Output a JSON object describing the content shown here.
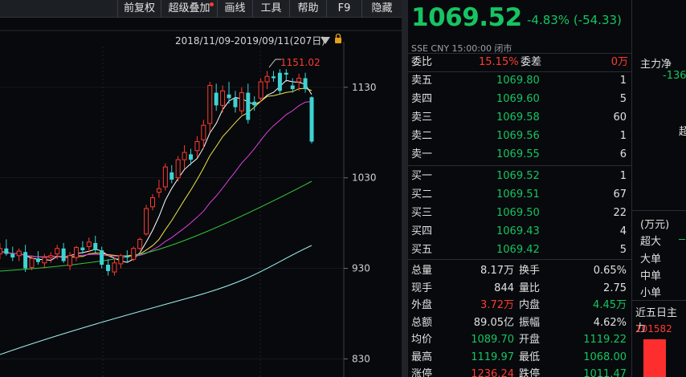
{
  "toolbar": {
    "items": [
      "前复权",
      "超级叠加",
      "画线",
      "工具",
      "帮助",
      "F9",
      "隐藏"
    ]
  },
  "chart": {
    "range_label": "2018/11/09-2019/09/11(207日)",
    "max_label": "1151.02",
    "y_ticks": [
      "1130",
      "1030",
      "930",
      "830"
    ],
    "ylim": [
      810,
      1175
    ]
  },
  "chart_data": {
    "type": "candlestick",
    "y_ticks": [
      1130,
      1030,
      930,
      830
    ],
    "max_price": 1151.02,
    "candles": [
      [
        940,
        950,
        932,
        945
      ],
      [
        946,
        958,
        940,
        952
      ],
      [
        952,
        962,
        944,
        946
      ],
      [
        946,
        954,
        938,
        942
      ],
      [
        944,
        952,
        938,
        949
      ],
      [
        948,
        956,
        926,
        930
      ],
      [
        931,
        944,
        928,
        941
      ],
      [
        941,
        949,
        934,
        937
      ],
      [
        936,
        946,
        930,
        942
      ],
      [
        942,
        948,
        936,
        944
      ],
      [
        946,
        956,
        940,
        952
      ],
      [
        952,
        958,
        936,
        938
      ],
      [
        933,
        948,
        928,
        944
      ],
      [
        942,
        955,
        938,
        953
      ],
      [
        953,
        960,
        946,
        950
      ],
      [
        954,
        964,
        948,
        959
      ],
      [
        958,
        966,
        947,
        950
      ],
      [
        950,
        954,
        930,
        934
      ],
      [
        934,
        940,
        922,
        927
      ],
      [
        926,
        942,
        922,
        936
      ],
      [
        935,
        946,
        930,
        944
      ],
      [
        944,
        950,
        936,
        942
      ],
      [
        940,
        954,
        938,
        952
      ],
      [
        952,
        964,
        950,
        962
      ],
      [
        968,
        1000,
        966,
        996
      ],
      [
        998,
        1012,
        994,
        1008
      ],
      [
        1014,
        1028,
        1008,
        1018
      ],
      [
        1020,
        1046,
        1016,
        1042
      ],
      [
        1036,
        1044,
        1024,
        1028
      ],
      [
        1030,
        1054,
        1026,
        1050
      ],
      [
        1050,
        1066,
        1040,
        1058
      ],
      [
        1056,
        1062,
        1044,
        1050
      ],
      [
        1060,
        1076,
        1052,
        1070
      ],
      [
        1072,
        1094,
        1062,
        1088
      ],
      [
        1090,
        1136,
        1080,
        1132
      ],
      [
        1124,
        1134,
        1104,
        1110
      ],
      [
        1110,
        1132,
        1102,
        1126
      ],
      [
        1122,
        1136,
        1112,
        1118
      ],
      [
        1118,
        1126,
        1102,
        1108
      ],
      [
        1104,
        1130,
        1100,
        1124
      ],
      [
        1124,
        1134,
        1090,
        1094
      ],
      [
        1114,
        1120,
        1104,
        1110
      ],
      [
        1118,
        1140,
        1114,
        1136
      ],
      [
        1136,
        1148,
        1128,
        1142
      ],
      [
        1142,
        1148,
        1136,
        1140
      ],
      [
        1146,
        1150,
        1122,
        1126
      ],
      [
        1146,
        1150,
        1136,
        1144
      ],
      [
        1132,
        1140,
        1124,
        1128
      ],
      [
        1136,
        1145,
        1126,
        1140
      ],
      [
        1140,
        1146,
        1124,
        1128
      ],
      [
        1119,
        1120,
        1068,
        1070
      ]
    ]
  },
  "quote": {
    "price": "1069.52",
    "change": "-4.83%  (-54.33)",
    "meta": "SSE  CNY  15:00:00  闭市",
    "weibi_label": "委比",
    "weibi_value": "15.15%",
    "weicha_label": "委差",
    "weicha_value": "0万"
  },
  "asks": [
    {
      "label": "卖五",
      "price": "1069.80",
      "vol": "1"
    },
    {
      "label": "卖四",
      "price": "1069.60",
      "vol": "5"
    },
    {
      "label": "卖三",
      "price": "1069.58",
      "vol": "60"
    },
    {
      "label": "卖二",
      "price": "1069.56",
      "vol": "1"
    },
    {
      "label": "卖一",
      "price": "1069.55",
      "vol": "6"
    }
  ],
  "bids": [
    {
      "label": "买一",
      "price": "1069.52",
      "vol": "1"
    },
    {
      "label": "买二",
      "price": "1069.51",
      "vol": "67"
    },
    {
      "label": "买三",
      "price": "1069.50",
      "vol": "22"
    },
    {
      "label": "买四",
      "price": "1069.43",
      "vol": "4"
    },
    {
      "label": "买五",
      "price": "1069.42",
      "vol": "5"
    }
  ],
  "stats": [
    {
      "l1": "总量",
      "v1": "8.17万",
      "c1": "#e0e0e0",
      "l2": "换手",
      "v2": "0.65%",
      "c2": "#e0e0e0"
    },
    {
      "l1": "现手",
      "v1": "844",
      "c1": "#e0e0e0",
      "l2": "量比",
      "v2": "2.75",
      "c2": "#e0e0e0"
    },
    {
      "l1": "外盘",
      "v1": "3.72万",
      "c1": "#ff3b30",
      "l2": "内盘",
      "v2": "4.45万",
      "c2": "#16c462"
    },
    {
      "l1": "总额",
      "v1": "89.05亿",
      "c1": "#e0e0e0",
      "l2": "振幅",
      "v2": "4.62%",
      "c2": "#e0e0e0"
    },
    {
      "l1": "均价",
      "v1": "1089.70",
      "c1": "#16c462",
      "l2": "开盘",
      "v2": "1119.22",
      "c2": "#16c462"
    },
    {
      "l1": "最高",
      "v1": "1119.97",
      "c1": "#16c462",
      "l2": "最低",
      "v2": "1068.00",
      "c2": "#16c462"
    },
    {
      "l1": "涨停",
      "v1": "1236.24",
      "c1": "#ff3b30",
      "l2": "跌停",
      "v2": "1011.47",
      "c2": "#16c462"
    }
  ],
  "far": {
    "title": "主力净",
    "value": "-136",
    "super": "超",
    "unit": "(万元)",
    "rows": [
      "超大",
      "大单",
      "中单",
      "小单"
    ],
    "five_day": "近五日主力",
    "five_value": "101582"
  },
  "colors": {
    "up": "#ff3b30",
    "down": "#16c462",
    "cyan": "#3ed3d3"
  }
}
